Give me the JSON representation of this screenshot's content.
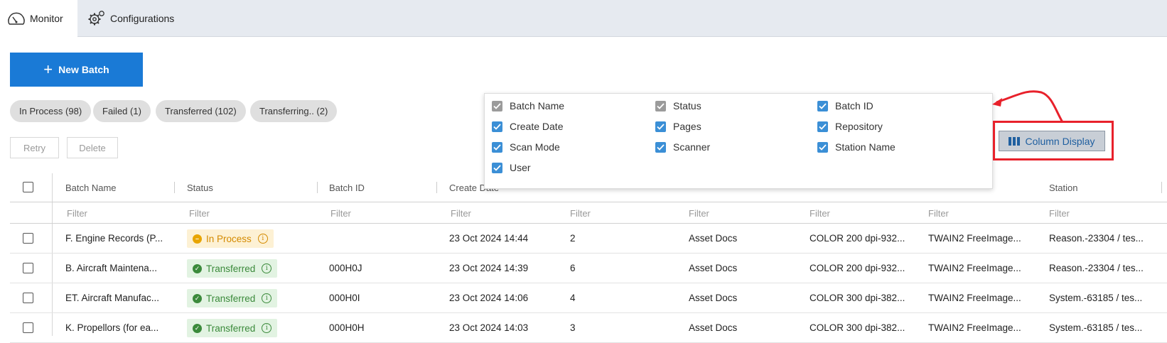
{
  "nav": {
    "monitor_label": "Monitor",
    "configurations_label": "Configurations"
  },
  "new_batch_label": "New Batch",
  "chips": [
    "In Process (98)",
    "Failed (1)",
    "Transferred (102)",
    "Transferring.. (2)"
  ],
  "actions": {
    "retry": "Retry",
    "delete": "Delete"
  },
  "columns": [
    "Batch Name",
    "Status",
    "Batch ID",
    "Create Date",
    "Station"
  ],
  "filter_placeholder": "Filter",
  "rows": [
    {
      "name": "F. Engine Records (P...",
      "status": "In Process",
      "status_type": "inproc",
      "id": "",
      "date": "23 Oct 2024 14:44",
      "pages": "2",
      "repo": "Asset Docs",
      "mode": "COLOR 200 dpi-932...",
      "scanner": "TWAIN2 FreeImage...",
      "station": "Reason.-23304 / tes..."
    },
    {
      "name": "B. Aircraft Maintena...",
      "status": "Transferred",
      "status_type": "trans",
      "id": "000H0J",
      "date": "23 Oct 2024 14:39",
      "pages": "6",
      "repo": "Asset Docs",
      "mode": "COLOR 200 dpi-932...",
      "scanner": "TWAIN2 FreeImage...",
      "station": "Reason.-23304 / tes..."
    },
    {
      "name": "ET. Aircraft Manufac...",
      "status": "Transferred",
      "status_type": "trans",
      "id": "000H0I",
      "date": "23 Oct 2024 14:06",
      "pages": "4",
      "repo": "Asset Docs",
      "mode": "COLOR 300 dpi-382...",
      "scanner": "TWAIN2 FreeImage...",
      "station": "System.-63185 / tes..."
    },
    {
      "name": "K. Propellors (for ea...",
      "status": "Transferred",
      "status_type": "trans",
      "id": "000H0H",
      "date": "23 Oct 2024 14:03",
      "pages": "3",
      "repo": "Asset Docs",
      "mode": "COLOR 300 dpi-382...",
      "scanner": "TWAIN2 FreeImage...",
      "station": "System.-63185 / tes..."
    }
  ],
  "column_display": {
    "button_label": "Column Display",
    "options": [
      {
        "label": "Batch Name",
        "state": "disabled"
      },
      {
        "label": "Status",
        "state": "disabled"
      },
      {
        "label": "Batch ID",
        "state": "checked"
      },
      {
        "label": "Create Date",
        "state": "checked"
      },
      {
        "label": "Pages",
        "state": "checked"
      },
      {
        "label": "Repository",
        "state": "checked"
      },
      {
        "label": "Scan Mode",
        "state": "checked"
      },
      {
        "label": "Scanner",
        "state": "checked"
      },
      {
        "label": "Station Name",
        "state": "checked"
      },
      {
        "label": "User",
        "state": "checked"
      }
    ]
  },
  "colors": {
    "primary": "#1a7ad6",
    "checkbox_on": "#3b8fd6",
    "annotation": "#e8212b"
  }
}
